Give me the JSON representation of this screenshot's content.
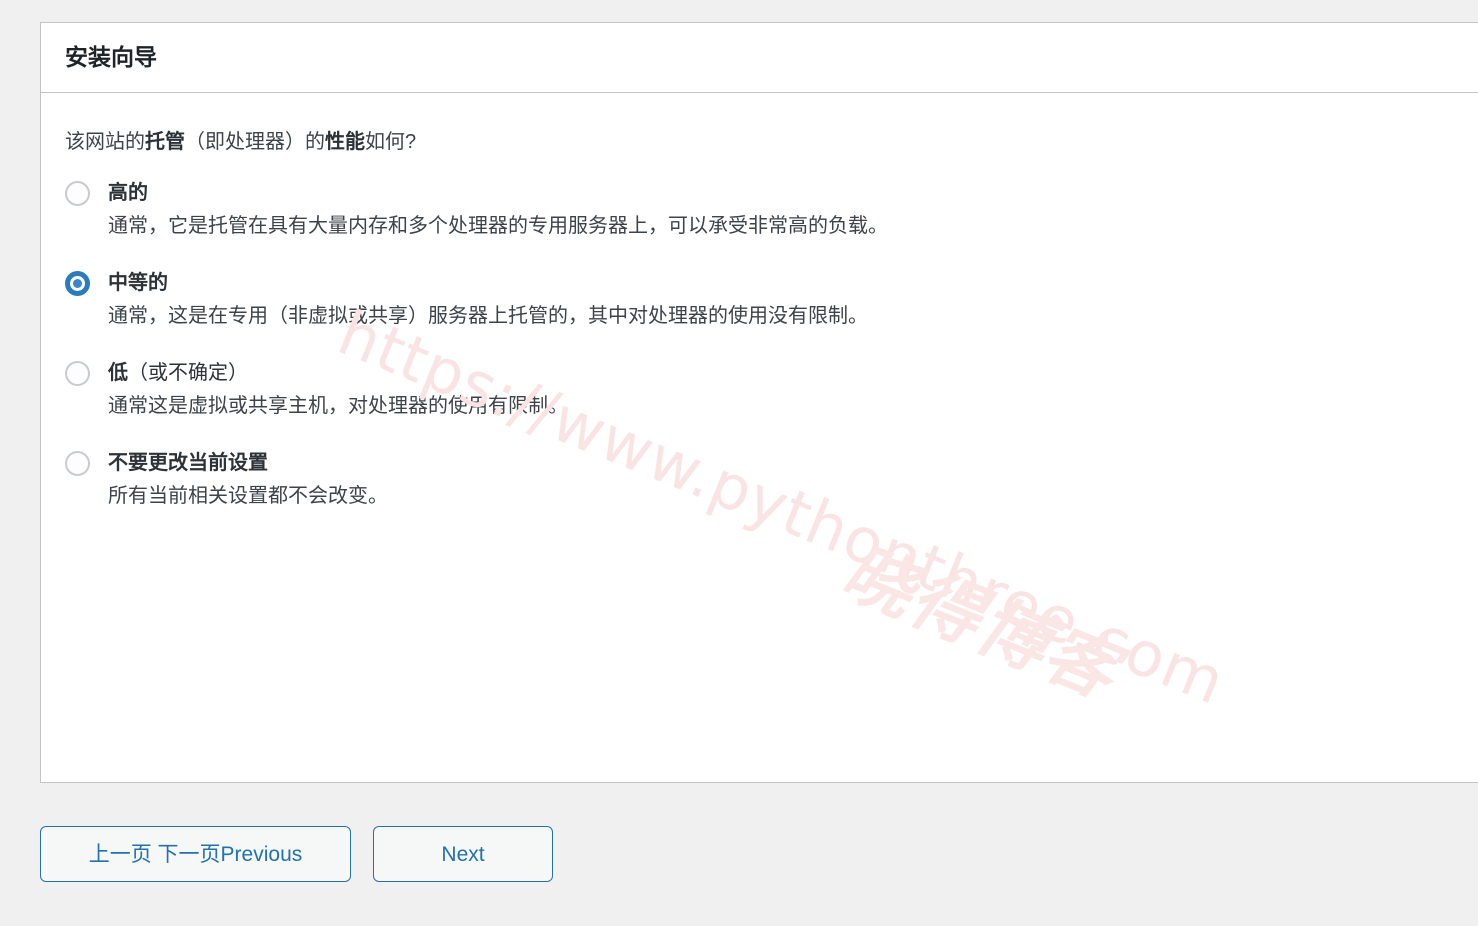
{
  "card": {
    "title": "安装向导"
  },
  "question": {
    "prefix": "该网站的",
    "bold1": "托管",
    "middle": "（即处理器）的",
    "bold2": "性能",
    "suffix": "如何?"
  },
  "options": [
    {
      "label": "高的",
      "label_normal": "",
      "description": "通常，它是托管在具有大量内存和多个处理器的专用服务器上，可以承受非常高的负载。",
      "selected": false
    },
    {
      "label": "中等的",
      "label_normal": "",
      "description": "通常，这是在专用（非虚拟或共享）服务器上托管的，其中对处理器的使用没有限制。",
      "selected": true
    },
    {
      "label": "低",
      "label_normal": "（或不确定）",
      "description": "通常这是虚拟或共享主机，对处理器的使用有限制。",
      "selected": false
    },
    {
      "label": "不要更改当前设置",
      "label_normal": "",
      "description": "所有当前相关设置都不会改变。",
      "selected": false
    }
  ],
  "buttons": {
    "previous_label": "上一页 下一页Previous",
    "next_label": "Next"
  },
  "watermark": {
    "url": "https://www.pythonthree.com",
    "brand": "晓得博客"
  },
  "colors": {
    "accent": "#2271b1",
    "radio_selected": "#2b7bbd",
    "page_background": "#f0f0f1",
    "card_border": "#c3c4c7",
    "text": "#3c434a",
    "heading": "#1d2327",
    "watermark": "#fae3e3"
  }
}
